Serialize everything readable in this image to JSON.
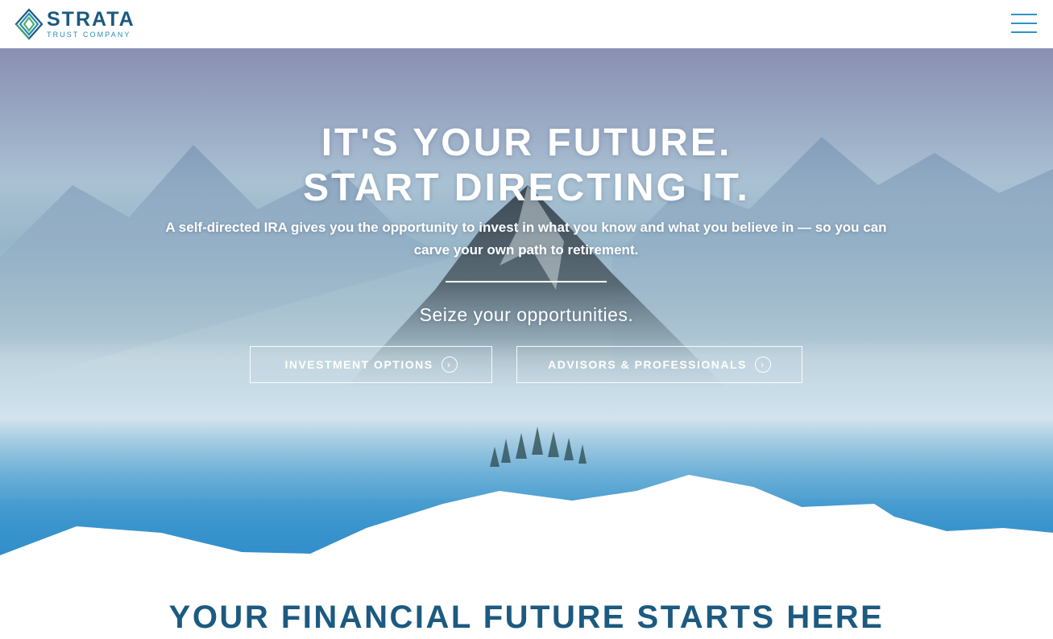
{
  "header": {
    "logo_name": "STRATA",
    "logo_sub": "TRUST COMPANY",
    "menu_icon": "hamburger-menu-icon"
  },
  "hero": {
    "headline_line1": "IT'S YOUR FUTURE.",
    "headline_line2": "START DIRECTING IT.",
    "subtext": "A self-directed IRA gives you the opportunity to invest in what you know and what you believe in — so you can carve your own path to retirement.",
    "tagline": "Seize your opportunities.",
    "buttons": [
      {
        "label": "INVESTMENT OPTIONS",
        "icon": "chevron-right-circle-icon"
      },
      {
        "label": "ADVISORS & PROFESSIONALS",
        "icon": "chevron-right-circle-icon"
      }
    ]
  },
  "section": {
    "title": "YOUR FINANCIAL FUTURE STARTS HERE"
  },
  "colors": {
    "brand_dark": "#1c5a80",
    "brand_light": "#2a94c8",
    "logo_green": "#4db06a"
  }
}
